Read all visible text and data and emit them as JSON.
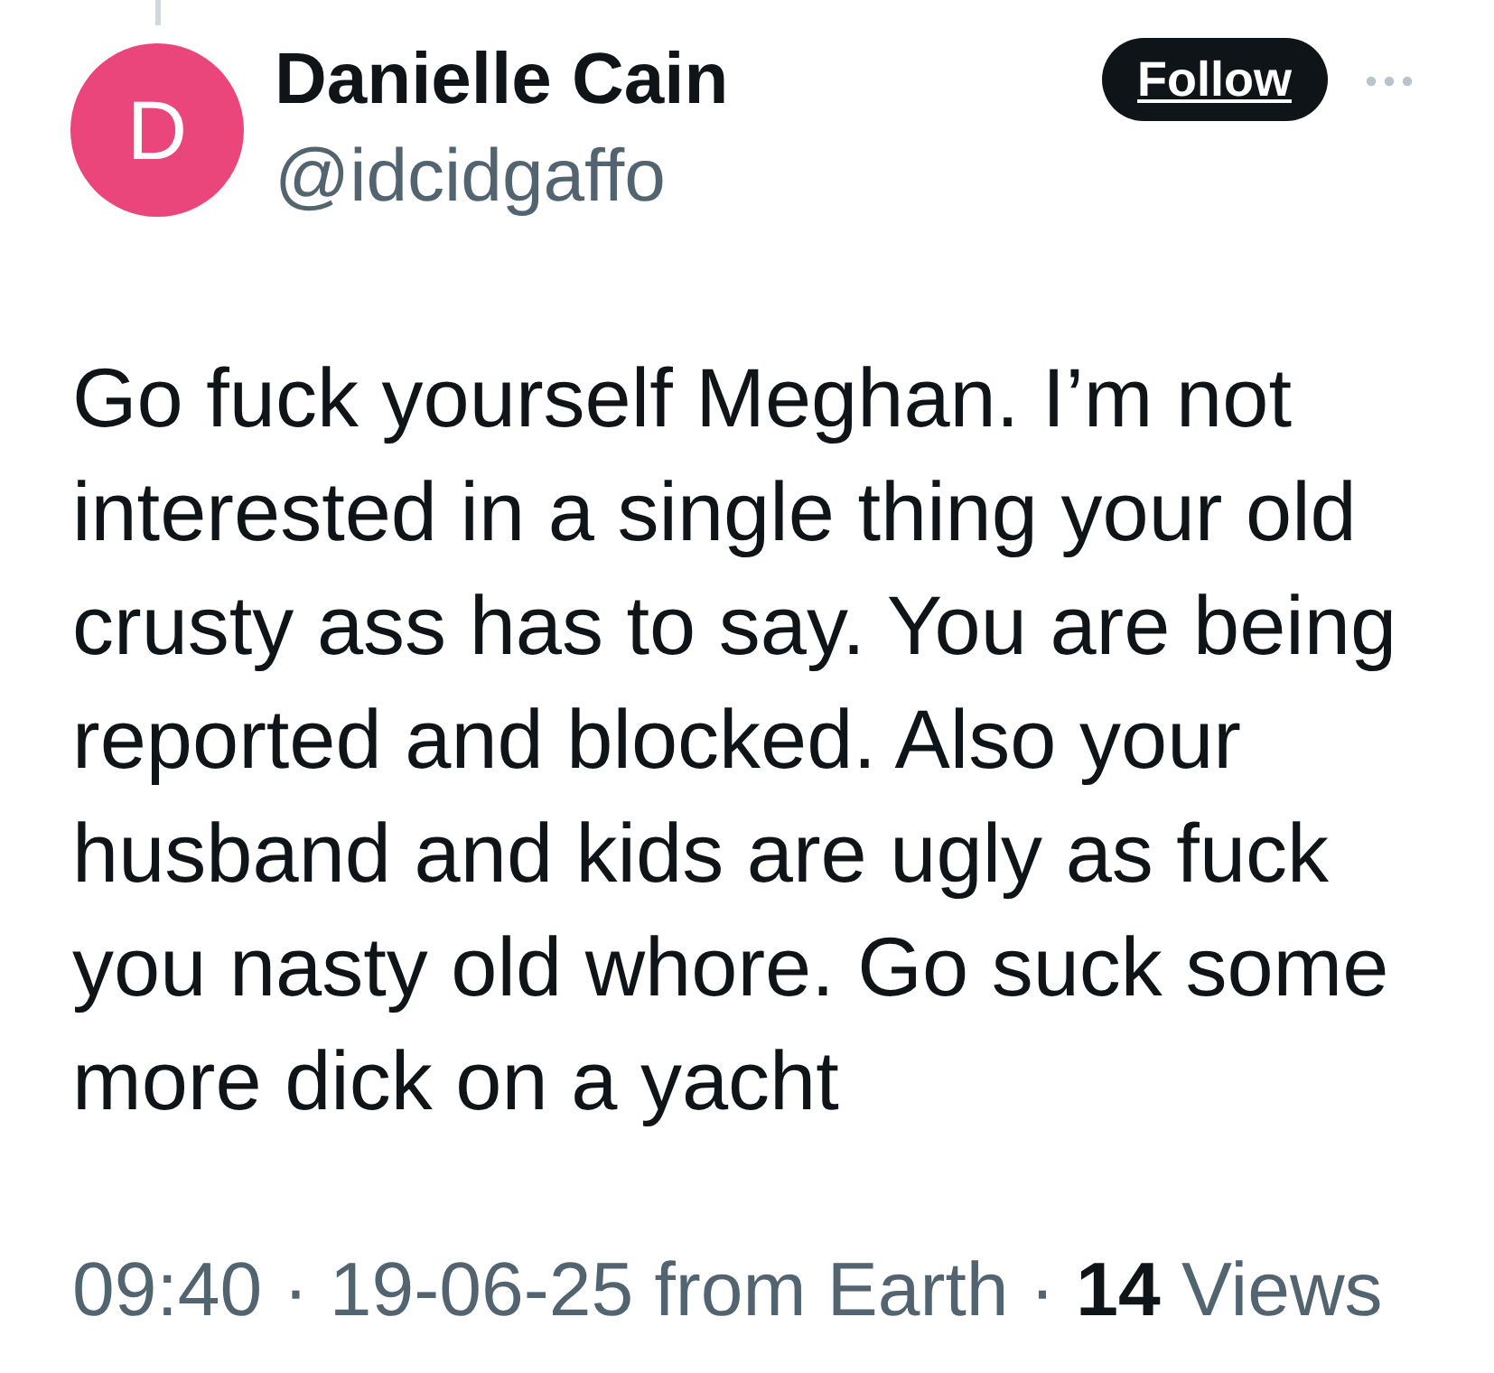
{
  "author": {
    "initial": "D",
    "name": "Danielle Cain",
    "handle": "@idcidgaffo"
  },
  "follow_button": {
    "label": "Follow"
  },
  "post": {
    "text": "Go fuck yourself Meghan. I’m not interested in a single thing your old crusty ass has to say. You are being reported and blocked. Also your husband and kids are ugly as fuck you nasty old whore. Go suck some more dick on a yacht"
  },
  "meta": {
    "line": "09:40 · 19-06-25 from Earth · **14** Views"
  }
}
